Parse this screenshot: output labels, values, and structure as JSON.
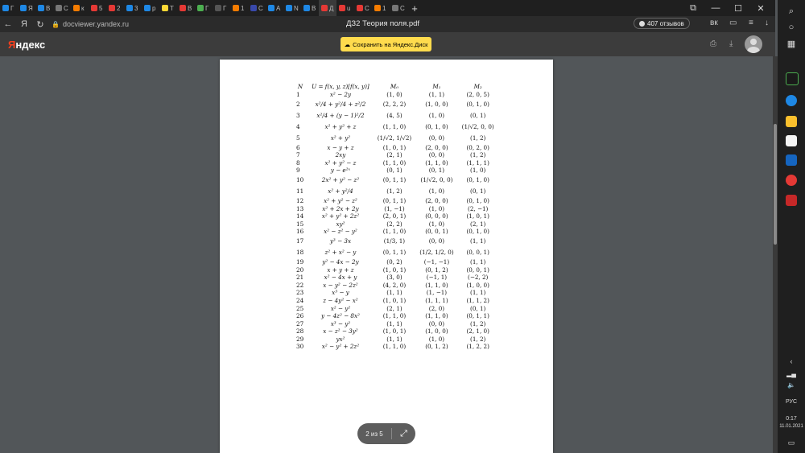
{
  "tabs": [
    {
      "label": "Г",
      "color": "#1e88e5"
    },
    {
      "label": "Я",
      "color": "#1e88e5"
    },
    {
      "label": "В",
      "color": "#1e88e5"
    },
    {
      "label": "С",
      "color": "#777777"
    },
    {
      "label": "к",
      "color": "#f57c00"
    },
    {
      "label": "5",
      "color": "#e53935"
    },
    {
      "label": "2",
      "color": "#e53935"
    },
    {
      "label": "3",
      "color": "#1e88e5"
    },
    {
      "label": "р",
      "color": "#1e88e5"
    },
    {
      "label": "Т",
      "color": "#fdd835"
    },
    {
      "label": "В",
      "color": "#e53935"
    },
    {
      "label": "Г",
      "color": "#4caf50"
    },
    {
      "label": "Г",
      "color": "#555555"
    },
    {
      "label": "1",
      "color": "#f57c00"
    },
    {
      "label": "С",
      "color": "#3949ab"
    },
    {
      "label": "А",
      "color": "#1e88e5"
    },
    {
      "label": "N",
      "color": "#1e88e5"
    },
    {
      "label": "В",
      "color": "#1e88e5"
    },
    {
      "label": "Д",
      "color": "#e53935"
    },
    {
      "label": "u",
      "color": "#e53935"
    },
    {
      "label": "С",
      "color": "#e53935"
    },
    {
      "label": "1",
      "color": "#f57c00"
    },
    {
      "label": "С",
      "color": "#777777"
    }
  ],
  "new_tab": "+",
  "window_controls": {
    "tabs_menu": "⧉",
    "minimize": "—",
    "maximize": "☐",
    "close": "✕"
  },
  "address_bar": {
    "back": "←",
    "logo": "Я",
    "reload": "↻",
    "url": "docviewer.yandex.ru",
    "tab_title": "ДЗ2 Теория поля.pdf",
    "reviews": "407 отзывов"
  },
  "yandex_header": {
    "logo_first": "Я",
    "logo_rest": "ндекс",
    "save_label": "Сохранить на Яндекс.Диск"
  },
  "document": {
    "headers": [
      "N",
      "U = f(x, y, z)[f(x, y)]",
      "M₀",
      "M₁",
      "M₂"
    ],
    "rows": [
      [
        "1",
        "x² − 2y",
        "(1, 0)",
        "(1, 1)",
        "(2, 0, 5)"
      ],
      [
        "2",
        "x²/4 + y²/4 + z²/2",
        "(2, 2, 2)",
        "(1, 0, 0)",
        "(0, 1, 0)"
      ],
      [
        "3",
        "x²/4 + (y − 1)²/2",
        "(4, 5)",
        "(1, 0)",
        "(0, 1)"
      ],
      [
        "4",
        "x² + y² + z",
        "(1, 1, 0)",
        "(0, 1, 0)",
        "(1/√2, 0, 0)"
      ],
      [
        "5",
        "x² + y²",
        "(1/√2, 1/√2)",
        "(0, 0)",
        "(1, 2)"
      ],
      [
        "6",
        "x − y + z",
        "(1, 0, 1)",
        "(2, 0, 0)",
        "(0, 2, 0)"
      ],
      [
        "7",
        "2xy",
        "(2, 1)",
        "(0, 0)",
        "(1, 2)"
      ],
      [
        "8",
        "x² + y² − z",
        "(1, 1, 0)",
        "(1, 1, 0)",
        "(1, 1, 1)"
      ],
      [
        "9",
        "y − e²ˣ",
        "(0, 1)",
        "(0, 1)",
        "(1, 0)"
      ],
      [
        "10",
        "2x² + y² − z²",
        "(0, 1, 1)",
        "(1/√2, 0, 0)",
        "(0, 1, 0)"
      ],
      [
        "11",
        "x² + y²/4",
        "(1, 2)",
        "(1, 0)",
        "(0, 1)"
      ],
      [
        "12",
        "x² + y² − z²",
        "(0, 1, 1)",
        "(2, 0, 0)",
        "(0, 1, 0)"
      ],
      [
        "13",
        "x² + 2x + 2y",
        "(1, −1)",
        "(1, 0)",
        "(2, −1)"
      ],
      [
        "14",
        "x² + y² + 2z²",
        "(2, 0, 1)",
        "(0, 0, 0)",
        "(1, 0, 1)"
      ],
      [
        "15",
        "xy²",
        "(2, 2)",
        "(1, 0)",
        "(2, 1)"
      ],
      [
        "16",
        "x² − z² − y²",
        "(1, 1, 0)",
        "(0, 0, 1)",
        "(0, 1, 0)"
      ],
      [
        "17",
        "y³ − 3x",
        "(1/3, 1)",
        "(0, 0)",
        "(1, 1)"
      ],
      [
        "18",
        "z² + x² − y",
        "(0, 1, 1)",
        "(1/2, 1/2, 0)",
        "(0, 0, 1)"
      ],
      [
        "19",
        "y² − 4x − 2y",
        "(0, 2)",
        "(−1, −1)",
        "(1, 1)"
      ],
      [
        "20",
        "x + y + z",
        "(1, 0, 1)",
        "(0, 1, 2)",
        "(0, 0, 1)"
      ],
      [
        "21",
        "x² − 4x + y",
        "(3, 0)",
        "(−1, 1)",
        "(−2, 2)"
      ],
      [
        "22",
        "x − y² − 2z²",
        "(4, 2, 0)",
        "(1, 1, 0)",
        "(1, 0, 0)"
      ],
      [
        "23",
        "x³ − y",
        "(1, 1)",
        "(1, −1)",
        "(1, 1)"
      ],
      [
        "24",
        "z − 4y² − x²",
        "(1, 0, 1)",
        "(1, 1, 1)",
        "(1, 1, 2)"
      ],
      [
        "25",
        "x² − y²",
        "(2, 1)",
        "(2, 0)",
        "(0, 1)"
      ],
      [
        "26",
        "y − 4z² − 8x²",
        "(1, 1, 0)",
        "(1, 1, 0)",
        "(0, 1, 1)"
      ],
      [
        "27",
        "x³ − y²",
        "(1, 1)",
        "(0, 0)",
        "(1, 2)"
      ],
      [
        "28",
        "x − z² − 3y²",
        "(1, 0, 1)",
        "(1, 0, 0)",
        "(2, 1, 0)"
      ],
      [
        "29",
        "yx²",
        "(1, 1)",
        "(1, 0)",
        "(1, 2)"
      ],
      [
        "30",
        "x² − y² + 2z²",
        "(1, 1, 0)",
        "(0, 1, 2)",
        "(1, 2, 2)"
      ]
    ]
  },
  "pager": {
    "label": "2 из 5",
    "fullscreen": "⤢"
  },
  "taskbar": {
    "lang": "РУС",
    "time": "0:17",
    "date": "11.01.2021"
  }
}
